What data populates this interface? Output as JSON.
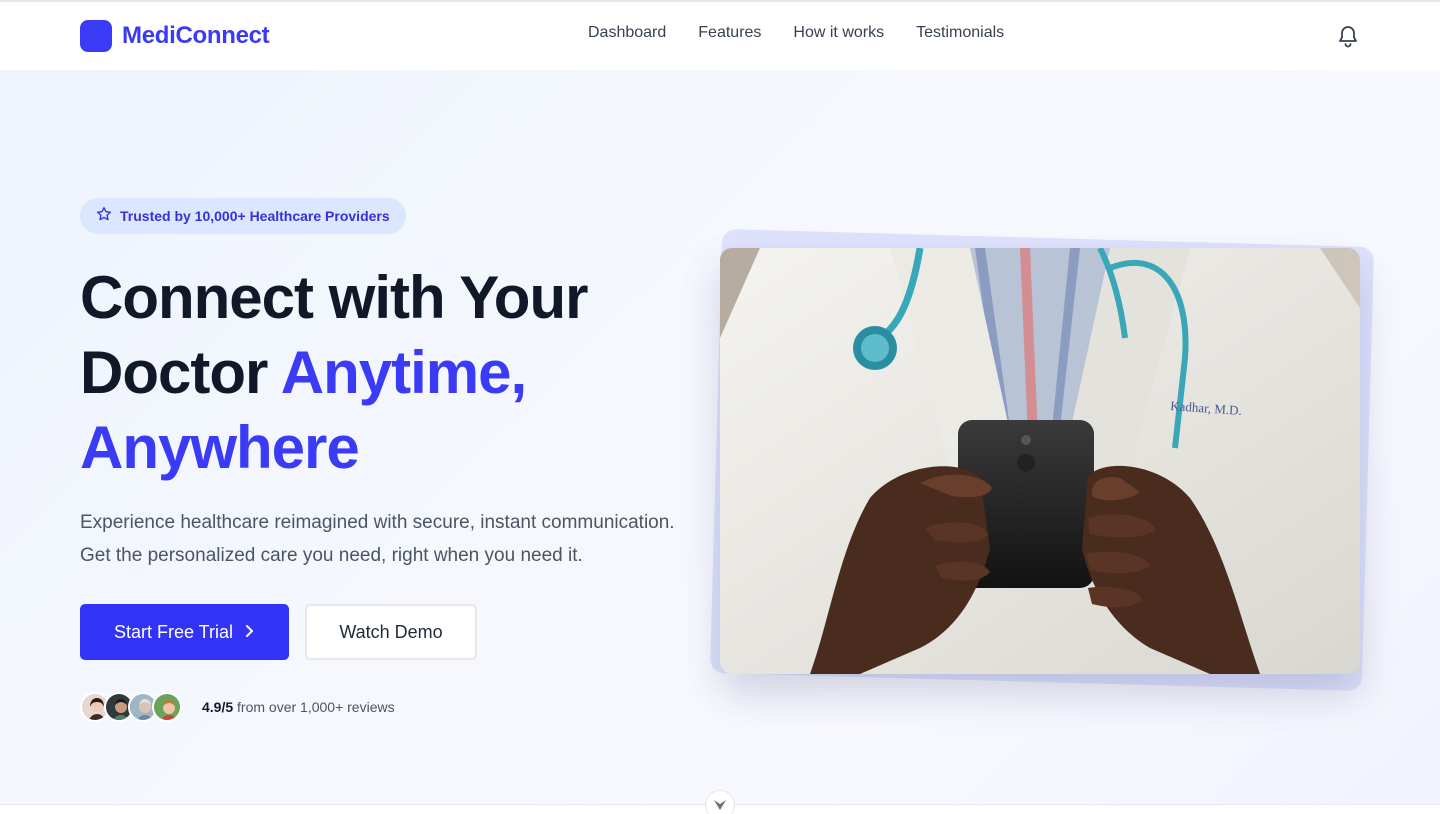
{
  "brand": {
    "name": "MediConnect",
    "color": "#3b3bf6"
  },
  "nav": {
    "items": [
      {
        "label": "Dashboard"
      },
      {
        "label": "Features"
      },
      {
        "label": "How it works"
      },
      {
        "label": "Testimonials"
      }
    ],
    "notification_icon": "bell-icon"
  },
  "hero": {
    "badge": {
      "icon": "star-icon",
      "text": "Trusted by 10,000+ Healthcare Providers"
    },
    "headline": {
      "line1": "Connect with Your",
      "line2_plain": "Doctor ",
      "line2_accent": "Anytime,",
      "line3_accent": "Anywhere"
    },
    "subtext": {
      "line1": "Experience healthcare reimagined with secure, instant communication.",
      "line2": "Get the personalized care you need, right when you need it."
    },
    "primary_cta": {
      "label": "Start Free Trial",
      "icon": "chevron-right-icon"
    },
    "secondary_cta": {
      "label": "Watch Demo"
    },
    "reviews": {
      "rating": "4.9/5",
      "text": " from over 1,000+ reviews",
      "avatar_count": 4
    },
    "image": {
      "subject": "doctor-holding-phone-photo"
    }
  },
  "scroll": {
    "icon": "chevron-down-icon"
  },
  "colors": {
    "accent": "#3b3bf6",
    "badge_bg": "#dbe7fe",
    "text_dark": "#111827",
    "text_muted": "#4b5563"
  }
}
